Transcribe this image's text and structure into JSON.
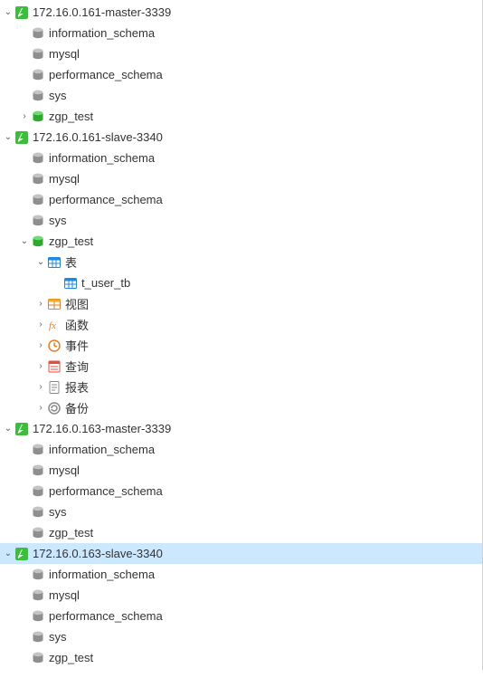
{
  "tree": [
    {
      "depth": 0,
      "expander": "open",
      "icon": "connection-green",
      "label": "172.16.0.161-master-3339",
      "selected": false
    },
    {
      "depth": 1,
      "expander": "none",
      "icon": "db-grey",
      "label": "information_schema",
      "selected": false
    },
    {
      "depth": 1,
      "expander": "none",
      "icon": "db-grey",
      "label": "mysql",
      "selected": false
    },
    {
      "depth": 1,
      "expander": "none",
      "icon": "db-grey",
      "label": "performance_schema",
      "selected": false
    },
    {
      "depth": 1,
      "expander": "none",
      "icon": "db-grey",
      "label": "sys",
      "selected": false
    },
    {
      "depth": 1,
      "expander": "closed",
      "icon": "db-green",
      "label": "zgp_test",
      "selected": false
    },
    {
      "depth": 0,
      "expander": "open",
      "icon": "connection-green",
      "label": "172.16.0.161-slave-3340",
      "selected": false
    },
    {
      "depth": 1,
      "expander": "none",
      "icon": "db-grey",
      "label": "information_schema",
      "selected": false
    },
    {
      "depth": 1,
      "expander": "none",
      "icon": "db-grey",
      "label": "mysql",
      "selected": false
    },
    {
      "depth": 1,
      "expander": "none",
      "icon": "db-grey",
      "label": "performance_schema",
      "selected": false
    },
    {
      "depth": 1,
      "expander": "none",
      "icon": "db-grey",
      "label": "sys",
      "selected": false
    },
    {
      "depth": 1,
      "expander": "open",
      "icon": "db-green",
      "label": "zgp_test",
      "selected": false
    },
    {
      "depth": 2,
      "expander": "open",
      "icon": "table-folder",
      "label": "表",
      "selected": false
    },
    {
      "depth": 3,
      "expander": "none",
      "icon": "table",
      "label": "t_user_tb",
      "selected": false
    },
    {
      "depth": 2,
      "expander": "closed",
      "icon": "view",
      "label": "视图",
      "selected": false
    },
    {
      "depth": 2,
      "expander": "closed",
      "icon": "function",
      "label": "函数",
      "selected": false
    },
    {
      "depth": 2,
      "expander": "closed",
      "icon": "event",
      "label": "事件",
      "selected": false
    },
    {
      "depth": 2,
      "expander": "closed",
      "icon": "query",
      "label": "查询",
      "selected": false
    },
    {
      "depth": 2,
      "expander": "closed",
      "icon": "report",
      "label": "报表",
      "selected": false
    },
    {
      "depth": 2,
      "expander": "closed",
      "icon": "backup",
      "label": "备份",
      "selected": false
    },
    {
      "depth": 0,
      "expander": "open",
      "icon": "connection-green",
      "label": "172.16.0.163-master-3339",
      "selected": false
    },
    {
      "depth": 1,
      "expander": "none",
      "icon": "db-grey",
      "label": "information_schema",
      "selected": false
    },
    {
      "depth": 1,
      "expander": "none",
      "icon": "db-grey",
      "label": "mysql",
      "selected": false
    },
    {
      "depth": 1,
      "expander": "none",
      "icon": "db-grey",
      "label": "performance_schema",
      "selected": false
    },
    {
      "depth": 1,
      "expander": "none",
      "icon": "db-grey",
      "label": "sys",
      "selected": false
    },
    {
      "depth": 1,
      "expander": "none",
      "icon": "db-grey",
      "label": "zgp_test",
      "selected": false
    },
    {
      "depth": 0,
      "expander": "open",
      "icon": "connection-green",
      "label": "172.16.0.163-slave-3340",
      "selected": true
    },
    {
      "depth": 1,
      "expander": "none",
      "icon": "db-grey",
      "label": "information_schema",
      "selected": false
    },
    {
      "depth": 1,
      "expander": "none",
      "icon": "db-grey",
      "label": "mysql",
      "selected": false
    },
    {
      "depth": 1,
      "expander": "none",
      "icon": "db-grey",
      "label": "performance_schema",
      "selected": false
    },
    {
      "depth": 1,
      "expander": "none",
      "icon": "db-grey",
      "label": "sys",
      "selected": false
    },
    {
      "depth": 1,
      "expander": "none",
      "icon": "db-grey",
      "label": "zgp_test",
      "selected": false
    }
  ]
}
